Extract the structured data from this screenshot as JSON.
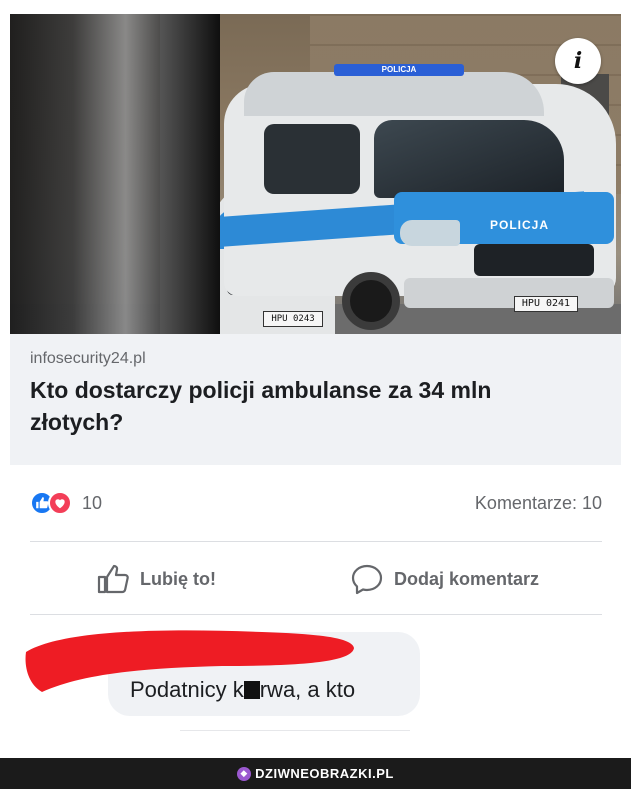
{
  "post": {
    "domain": "infosecurity24.pl",
    "headline": "Kto dostarczy policji ambulanse za 34 mln złotych?",
    "van_label": "POLICJA",
    "plate_main": "HPU 0241",
    "plate_left": "HPU 0243",
    "info_glyph": "i"
  },
  "stats": {
    "reaction_count": "10",
    "comments_label": "Komentarze: 10"
  },
  "actions": {
    "like_label": "Lubię to!",
    "comment_label": "Dodaj komentarz"
  },
  "comment": {
    "text_before": "Podatnicy k",
    "text_after": "rwa, a kto"
  },
  "footer": {
    "site": "DZIWNEOBRAZKI.PL"
  },
  "colors": {
    "like_blue": "#1877f2",
    "love_red": "#f33e58",
    "redaction_red": "#ee1c24",
    "police_blue": "#2d8ad6"
  }
}
